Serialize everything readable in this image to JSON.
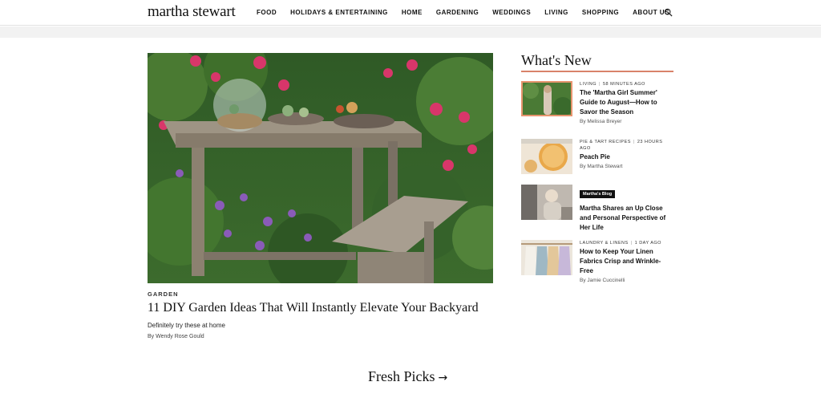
{
  "header": {
    "logo": "martha stewart",
    "nav": [
      "FOOD",
      "HOLIDAYS & ENTERTAINING",
      "HOME",
      "GARDENING",
      "WEDDINGS",
      "LIVING",
      "SHOPPING",
      "ABOUT US"
    ],
    "search_icon": "search-icon"
  },
  "hero": {
    "category": "GARDEN",
    "title": "11 DIY Garden Ideas That Will Instantly Elevate Your Backyard",
    "dek": "Definitely try these at home",
    "byline": "By Wendy Rose Gould"
  },
  "whats_new": {
    "title": "What's New",
    "items": [
      {
        "category": "LIVING",
        "time": "58 MINUTES AGO",
        "headline": "The 'Martha Girl Summer' Guide to August—How to Savor the Season",
        "byline": "By Melissa Breyer"
      },
      {
        "category": "PIE & TART RECIPES",
        "time": "23 HOURS AGO",
        "headline": "Peach Pie",
        "byline": "By Martha Stewart"
      },
      {
        "badge": "Martha's Blog",
        "headline": "Martha Shares an Up Close and Personal Perspective of Her Life"
      },
      {
        "category": "LAUNDRY & LINENS",
        "time": "1 DAY AGO",
        "headline": "How to Keep Your Linen Fabrics Crisp and Wrinkle-Free",
        "byline": "By Jamie Cuccinelli"
      }
    ]
  },
  "fresh_picks": {
    "label": "Fresh Picks",
    "arrow": "→"
  },
  "colors": {
    "accent_rule": "#d9826a",
    "thumb_border": "#e8956f"
  }
}
